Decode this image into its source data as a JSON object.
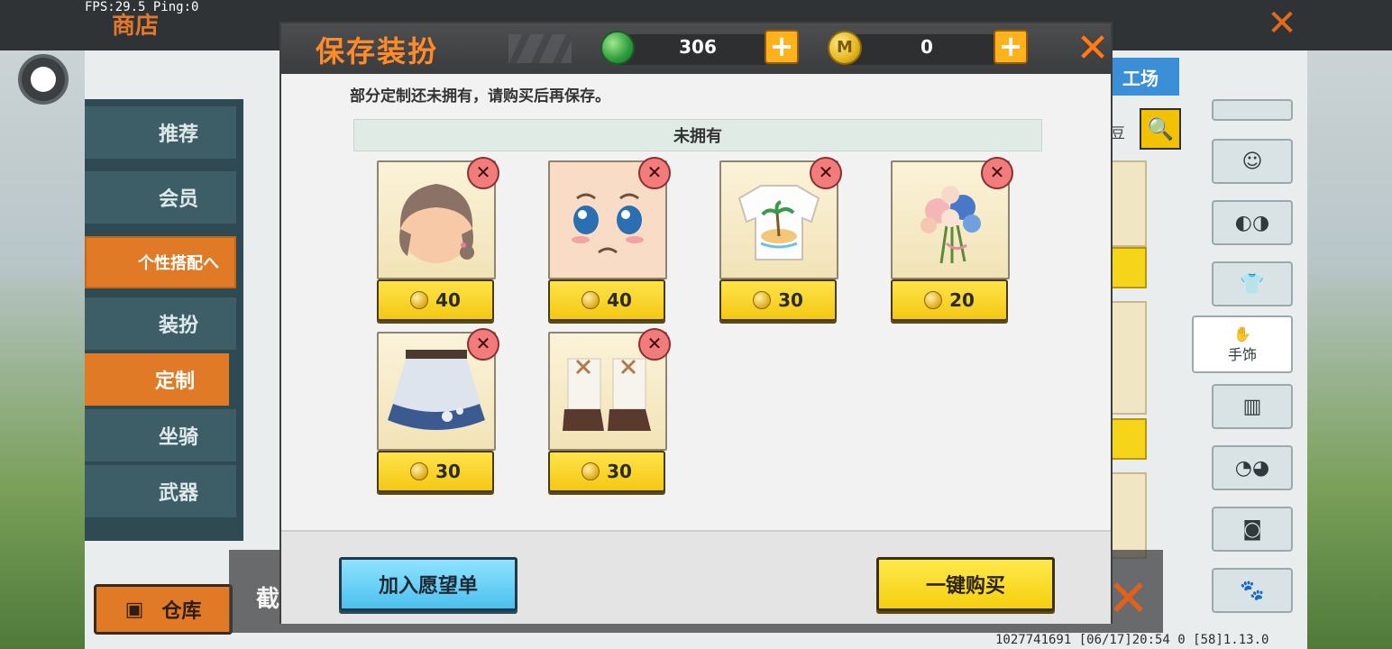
{
  "overlay": {
    "fps": "FPS:29.5  Ping:0"
  },
  "background": {
    "shop_title": "商店",
    "side_menu": [
      "推荐",
      "会员",
      "个性搭配へ",
      "装扮",
      "定制",
      "坐骑",
      "武器"
    ],
    "warehouse_label": "仓库",
    "workshop_tab": "工场",
    "bean_text": "豆",
    "hand_accessory_label": "手饰",
    "screenshot_label": "截",
    "version_text": "1027741691    [06/17]20:54 0   [58]1.13.0"
  },
  "modal": {
    "title": "保存装扮",
    "currency": {
      "gems": "306",
      "coins": "0"
    },
    "notice": "部分定制还未拥有，请购买后再保存。",
    "section_label": "未拥有",
    "items": [
      {
        "name": "brown-braided-hair",
        "price": "40"
      },
      {
        "name": "crying-face",
        "price": "40"
      },
      {
        "name": "palm-island-tshirt",
        "price": "30"
      },
      {
        "name": "flower-bouquet",
        "price": "20"
      },
      {
        "name": "blue-floral-skirt",
        "price": "30"
      },
      {
        "name": "white-brown-boots",
        "price": "30"
      }
    ],
    "remove_glyph": "✕",
    "wishlist_button": "加入愿望单",
    "buy_all_button": "一键购买"
  },
  "colors": {
    "title_orange": "#ff8a2a",
    "price_yellow": "#f4c814",
    "wish_blue": "#4cc0ee",
    "remove_red": "#f27b7b"
  }
}
